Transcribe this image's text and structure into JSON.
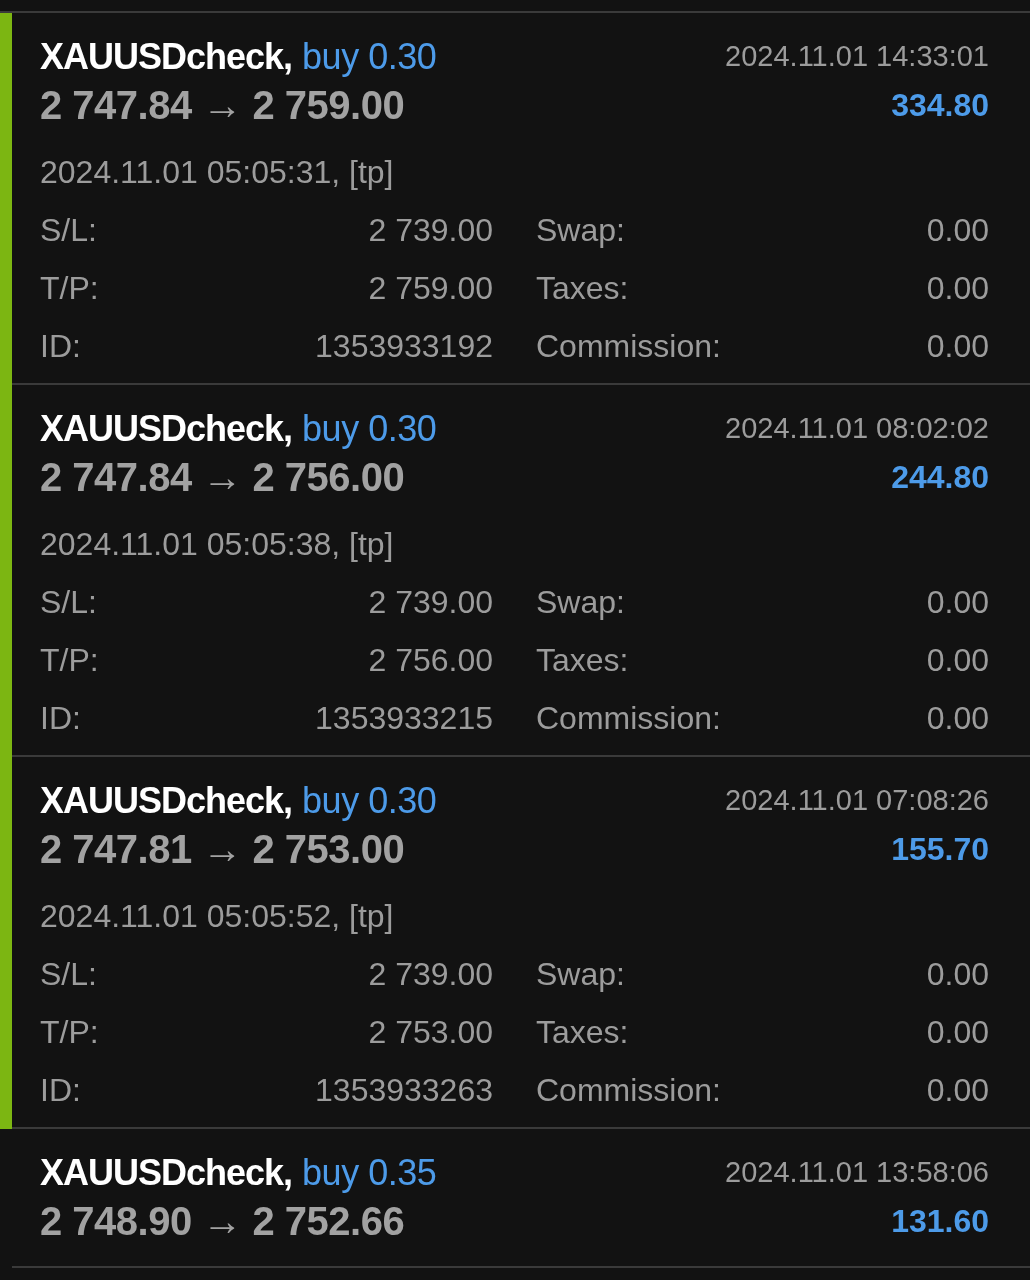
{
  "trades": [
    {
      "symbol": "XAUUSDcheck,",
      "side": "buy 0.30",
      "close_time": "2024.11.01 14:33:01",
      "prices": "2 747.84 → 2 759.00",
      "profit": "334.80",
      "expanded": true,
      "open_time": "2024.11.01 05:05:31, [tp]",
      "details": [
        {
          "label": "S/L:",
          "value": "2 739.00"
        },
        {
          "label": "Swap:",
          "value": "0.00"
        },
        {
          "label": "T/P:",
          "value": "2 759.00"
        },
        {
          "label": "Taxes:",
          "value": "0.00"
        },
        {
          "label": "ID:",
          "value": "1353933192"
        },
        {
          "label": "Commission:",
          "value": "0.00"
        }
      ]
    },
    {
      "symbol": "XAUUSDcheck,",
      "side": "buy 0.30",
      "close_time": "2024.11.01 08:02:02",
      "prices": "2 747.84 → 2 756.00",
      "profit": "244.80",
      "expanded": true,
      "open_time": "2024.11.01 05:05:38, [tp]",
      "details": [
        {
          "label": "S/L:",
          "value": "2 739.00"
        },
        {
          "label": "Swap:",
          "value": "0.00"
        },
        {
          "label": "T/P:",
          "value": "2 756.00"
        },
        {
          "label": "Taxes:",
          "value": "0.00"
        },
        {
          "label": "ID:",
          "value": "1353933215"
        },
        {
          "label": "Commission:",
          "value": "0.00"
        }
      ]
    },
    {
      "symbol": "XAUUSDcheck,",
      "side": "buy 0.30",
      "close_time": "2024.11.01 07:08:26",
      "prices": "2 747.81 → 2 753.00",
      "profit": "155.70",
      "expanded": true,
      "open_time": "2024.11.01 05:05:52, [tp]",
      "details": [
        {
          "label": "S/L:",
          "value": "2 739.00"
        },
        {
          "label": "Swap:",
          "value": "0.00"
        },
        {
          "label": "T/P:",
          "value": "2 753.00"
        },
        {
          "label": "Taxes:",
          "value": "0.00"
        },
        {
          "label": "ID:",
          "value": "1353933263"
        },
        {
          "label": "Commission:",
          "value": "0.00"
        }
      ]
    },
    {
      "symbol": "XAUUSDcheck,",
      "side": "buy 0.35",
      "close_time": "2024.11.01 13:58:06",
      "prices": "2 748.90 → 2 752.66",
      "profit": "131.60",
      "expanded": false
    }
  ]
}
